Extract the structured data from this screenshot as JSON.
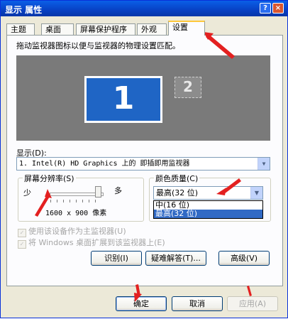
{
  "window": {
    "title": "显示 属性",
    "help_btn": "?",
    "close_btn": "×"
  },
  "tabs": [
    {
      "label": "主题"
    },
    {
      "label": "桌面"
    },
    {
      "label": "屏幕保护程序"
    },
    {
      "label": "外观"
    },
    {
      "label": "设置",
      "active": true
    }
  ],
  "settings": {
    "description": "拖动监视器图标以便与监视器的物理设置匹配。",
    "monitor1": "1",
    "monitor2": "2",
    "display_label": "显示(D):",
    "display_value": "1. Intel(R) HD Graphics 上的 即插即用监视器",
    "resolution": {
      "group_label": "屏幕分辨率(S)",
      "less": "少",
      "more": "多",
      "value": "1600 x 900 像素"
    },
    "color": {
      "group_label": "颜色质量(C)",
      "selected": "最高(32 位)",
      "options": [
        "中(16 位)",
        "最高(32 位)"
      ]
    },
    "check_primary": "使用该设备作为主监视器(U)",
    "check_extend": "将 Windows 桌面扩展到该监视器上(E)",
    "btn_identify": "识别(I)",
    "btn_troubleshoot": "疑难解答(T)...",
    "btn_advanced": "高级(V)"
  },
  "footer": {
    "ok": "确定",
    "cancel": "取消",
    "apply": "应用(A)"
  },
  "colors": {
    "titlebar": "#0841c4",
    "monitor_bg": "#7a7a7a",
    "monitor1_fill": "#1f65c5",
    "selection": "#316ac5",
    "annotation_arrow": "#e32020"
  }
}
